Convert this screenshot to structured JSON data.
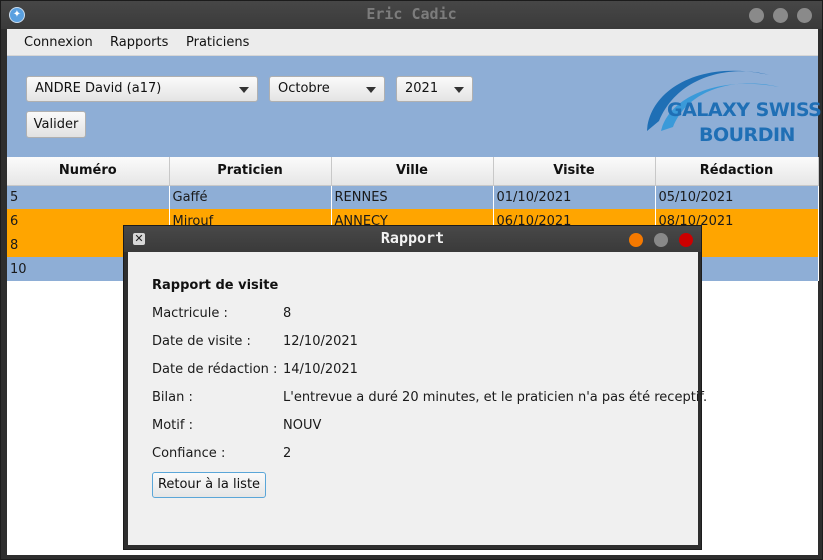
{
  "window": {
    "title": "Eric Cadic",
    "app_icon": "app-icon"
  },
  "menu": {
    "items": [
      "Connexion",
      "Rapports",
      "Praticiens"
    ]
  },
  "filters": {
    "visitor": "ANDRE David (a17)",
    "month": "Octobre",
    "year": "2021",
    "validate_label": "Valider"
  },
  "logo": {
    "line1": "GALAXY SWISS",
    "line2": "BOURDIN",
    "color": "#1f6fb5"
  },
  "table": {
    "columns": [
      "Numéro",
      "Praticien",
      "Ville",
      "Visite",
      "Rédaction"
    ],
    "rows": [
      {
        "cells": [
          "5",
          "Gaffé",
          "RENNES",
          "01/10/2021",
          "05/10/2021"
        ],
        "color": "blue"
      },
      {
        "cells": [
          "6",
          "Mirouf",
          "ANNECY",
          "06/10/2021",
          "08/10/2021"
        ],
        "color": "orange"
      },
      {
        "cells": [
          "8",
          "",
          "",
          "",
          "021"
        ],
        "color": "orange"
      },
      {
        "cells": [
          "10",
          "",
          "",
          "",
          "021"
        ],
        "color": "blue"
      }
    ]
  },
  "dialog": {
    "title": "Rapport",
    "heading": "Rapport de visite",
    "fields": [
      {
        "label": "Mactricule :",
        "value": "8"
      },
      {
        "label": "Date de visite :",
        "value": "12/10/2021"
      },
      {
        "label": "Date de rédaction :",
        "value": "14/10/2021"
      },
      {
        "label": "Bilan :",
        "value": "L'entrevue a duré 20 minutes, et le praticien n'a pas été receptif."
      },
      {
        "label": "Motif :",
        "value": "NOUV"
      },
      {
        "label": "Confiance :",
        "value": "2"
      }
    ],
    "back_label": "Retour à la liste"
  },
  "colors": {
    "accent_blue": "#8eaed6",
    "row_orange": "#ffa500",
    "dialog_minimize": "#f57900",
    "dialog_maximize": "#888888",
    "dialog_close": "#cc0000"
  }
}
